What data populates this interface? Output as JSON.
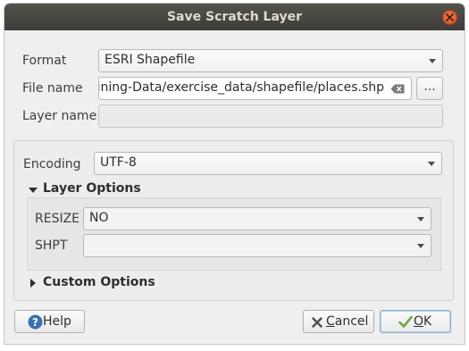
{
  "window": {
    "title": "Save Scratch Layer"
  },
  "form": {
    "format_label": "Format",
    "format_value": "ESRI Shapefile",
    "filename_label": "File name",
    "filename_value": "aining-Data/exercise_data/shapefile/places.shp",
    "browse_label": "...",
    "layername_label": "Layer name",
    "layername_value": ""
  },
  "options": {
    "encoding_label": "Encoding",
    "encoding_value": "UTF-8",
    "layer_options_label": "Layer Options",
    "resize_label": "RESIZE",
    "resize_value": "NO",
    "shpt_label": "SHPT",
    "shpt_value": "",
    "custom_options_label": "Custom Options"
  },
  "buttons": {
    "help": "Help",
    "cancel_mnemonic": "C",
    "cancel_rest": "ancel",
    "ok_mnemonic": "O",
    "ok_rest": "K"
  },
  "icons": {
    "close": "close-icon",
    "clear": "clear-icon",
    "help": "help-icon",
    "cancel": "cancel-x-icon",
    "ok": "checkmark-icon"
  },
  "colors": {
    "titlebar": "#3e3d39",
    "close_button": "#e05a26",
    "help_icon": "#3a6fb0",
    "ok_check": "#6aa84f"
  }
}
